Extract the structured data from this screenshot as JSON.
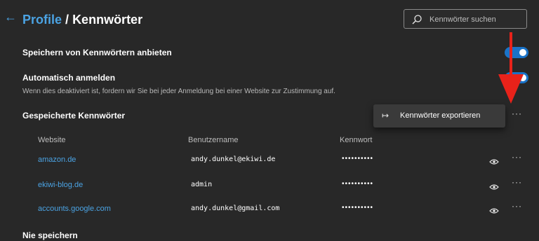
{
  "header": {
    "breadcrumb_parent": "Profile",
    "separator": "/",
    "title": "Kennwörter",
    "search_placeholder": "Kennwörter suchen"
  },
  "settings": {
    "offer_save": {
      "label": "Speichern von Kennwörtern anbieten",
      "enabled": true
    },
    "auto_signin": {
      "label": "Automatisch anmelden",
      "description": "Wenn dies deaktiviert ist, fordern wir Sie bei jeder Anmeldung bei einer Website zur Zustimmung auf.",
      "enabled": true
    }
  },
  "saved_passwords": {
    "heading": "Gespeicherte Kennwörter",
    "more_label": "···",
    "columns": [
      "Website",
      "Benutzername",
      "Kennwort"
    ],
    "rows": [
      {
        "website": "amazon.de",
        "username": "andy.dunkel@ekiwi.de",
        "password": "••••••••••",
        "more": "···"
      },
      {
        "website": "ekiwi-blog.de",
        "username": "admin",
        "password": "••••••••••",
        "more": "···"
      },
      {
        "website": "accounts.google.com",
        "username": "andy.dunkel@gmail.com",
        "password": "••••••••••",
        "more": "···"
      }
    ]
  },
  "context_menu": {
    "items": [
      {
        "icon": "export-icon",
        "glyph": "↦",
        "label": "Kennwörter exportieren"
      }
    ]
  },
  "never_saved": {
    "heading": "Nie speichern"
  },
  "annotation": {
    "arrow_color": "#e8221a"
  },
  "colors": {
    "accent": "#4ba3e3",
    "toggle_on": "#1a73c8",
    "background": "#282828"
  }
}
